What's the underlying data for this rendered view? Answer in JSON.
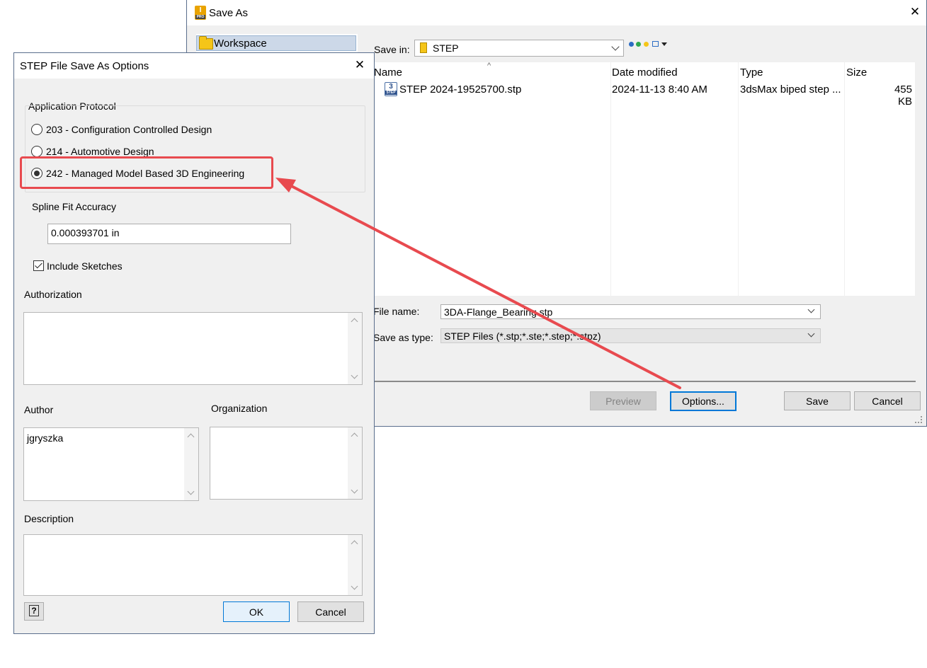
{
  "save_as": {
    "title": "Save As",
    "app_icon_letter": "I",
    "app_icon_sub": "PRO",
    "places": [
      "Workspace"
    ],
    "save_in_label": "Save in:",
    "save_in_value": "STEP",
    "columns": [
      "Name",
      "Date modified",
      "Type",
      "Size"
    ],
    "files": [
      {
        "name": "STEP 2024-19525700.stp",
        "date_modified": "2024-11-13 8:40 AM",
        "type": "3dsMax biped step ...",
        "size": "455 KB",
        "icon_digit": "3",
        "icon_label": "STEP"
      }
    ],
    "file_name_label": "File name:",
    "file_name_value": "3DA-Flange_Bearing.stp",
    "save_as_type_label": "Save as type:",
    "save_as_type_value": "STEP Files (*.stp;*.ste;*.step;*.stpz)",
    "buttons": {
      "preview": "Preview",
      "options": "Options...",
      "save": "Save",
      "cancel": "Cancel"
    }
  },
  "step_options": {
    "title": "STEP File Save As Options",
    "application_protocol_label": "Application Protocol",
    "protocols": [
      {
        "label": "203 - Configuration Controlled Design",
        "selected": false
      },
      {
        "label": "214 - Automotive Design",
        "selected": false
      },
      {
        "label": "242 - Managed Model Based 3D Engineering",
        "selected": true
      }
    ],
    "spline_fit_label": "Spline Fit Accuracy",
    "spline_fit_value": "0.000393701 in",
    "include_sketches_label": "Include Sketches",
    "include_sketches_checked": true,
    "authorization_label": "Authorization",
    "authorization_value": "",
    "author_label": "Author",
    "author_value": "jgryszka",
    "organization_label": "Organization",
    "organization_value": "",
    "description_label": "Description",
    "description_value": "",
    "help_glyph": "?",
    "buttons": {
      "ok": "OK",
      "cancel": "Cancel"
    }
  },
  "colors": {
    "annotation": "#e84a4f",
    "focus_blue": "#0078d7",
    "selection": "#ccd8e8"
  }
}
